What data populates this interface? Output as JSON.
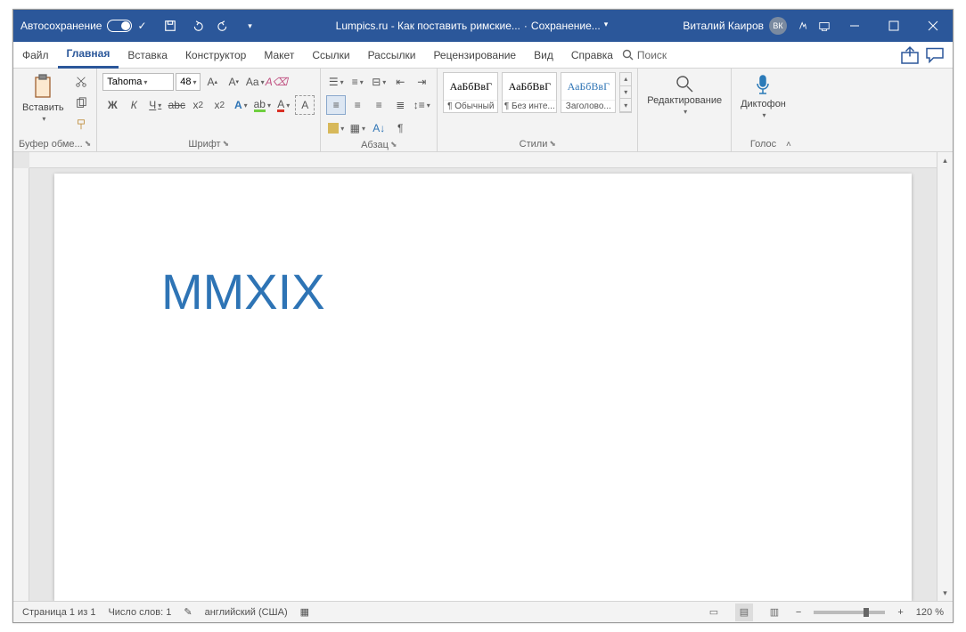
{
  "titlebar": {
    "autosave": "Автосохранение",
    "doc_title": "Lumpics.ru - Как поставить римские...",
    "saving": "Сохранение...",
    "user_name": "Виталий Каиров",
    "user_initials": "ВК"
  },
  "tabs": {
    "file": "Файл",
    "home": "Главная",
    "insert": "Вставка",
    "design": "Конструктор",
    "layout": "Макет",
    "references": "Ссылки",
    "mailings": "Рассылки",
    "review": "Рецензирование",
    "view": "Вид",
    "help": "Справка",
    "search": "Поиск"
  },
  "ribbon": {
    "clipboard": {
      "label": "Буфер обме...",
      "paste": "Вставить"
    },
    "font": {
      "label": "Шрифт",
      "name": "Tahoma",
      "size": "48",
      "bold": "Ж",
      "italic": "К",
      "underline": "Ч",
      "strike": "abc",
      "sub": "x₂",
      "sup": "x²"
    },
    "paragraph": {
      "label": "Абзац"
    },
    "styles": {
      "label": "Стили",
      "preview": "АаБбВвГ",
      "s1": "¶ Обычный",
      "s2": "¶ Без инте...",
      "s3": "Заголово..."
    },
    "editing": {
      "label": "Редактирование"
    },
    "voice": {
      "label": "Голос",
      "dictate": "Диктофон"
    }
  },
  "document": {
    "text": "MMXIX"
  },
  "status": {
    "page": "Страница 1 из 1",
    "words": "Число слов: 1",
    "lang": "английский (США)",
    "zoom": "120 %",
    "minus": "−",
    "plus": "+"
  }
}
